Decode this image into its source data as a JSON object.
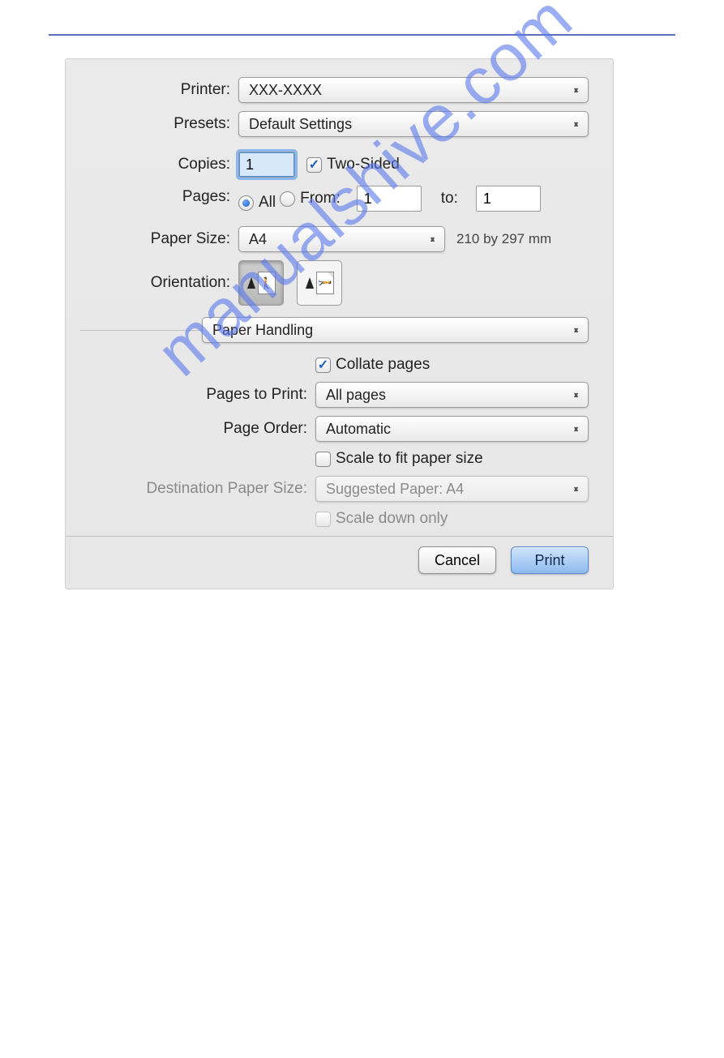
{
  "watermark": "manualshive.com",
  "labels": {
    "printer": "Printer:",
    "presets": "Presets:",
    "copies": "Copies:",
    "pages": "Pages:",
    "paper_size": "Paper Size:",
    "orientation": "Orientation:",
    "pages_to_print": "Pages to Print:",
    "page_order": "Page Order:",
    "destination_paper_size": "Destination Paper Size:"
  },
  "printer": {
    "value": "XXX-XXXX"
  },
  "presets": {
    "value": "Default Settings"
  },
  "copies": {
    "value": "1"
  },
  "two_sided": {
    "label": "Two-Sided",
    "checked": true
  },
  "pages": {
    "all_label": "All",
    "from_label": "From:",
    "to_label": "to:",
    "from_value": "1",
    "to_value": "1",
    "selected": "all"
  },
  "paper_size": {
    "value": "A4",
    "note": "210 by 297 mm"
  },
  "section": {
    "value": "Paper Handling"
  },
  "collate": {
    "label": "Collate pages",
    "checked": true
  },
  "pages_to_print": {
    "value": "All pages"
  },
  "page_order": {
    "value": "Automatic"
  },
  "scale_fit": {
    "label": "Scale to fit paper size",
    "checked": false
  },
  "dest_paper_size": {
    "value": "Suggested Paper: A4"
  },
  "scale_down": {
    "label": "Scale down only",
    "checked": false
  },
  "buttons": {
    "cancel": "Cancel",
    "print": "Print"
  }
}
